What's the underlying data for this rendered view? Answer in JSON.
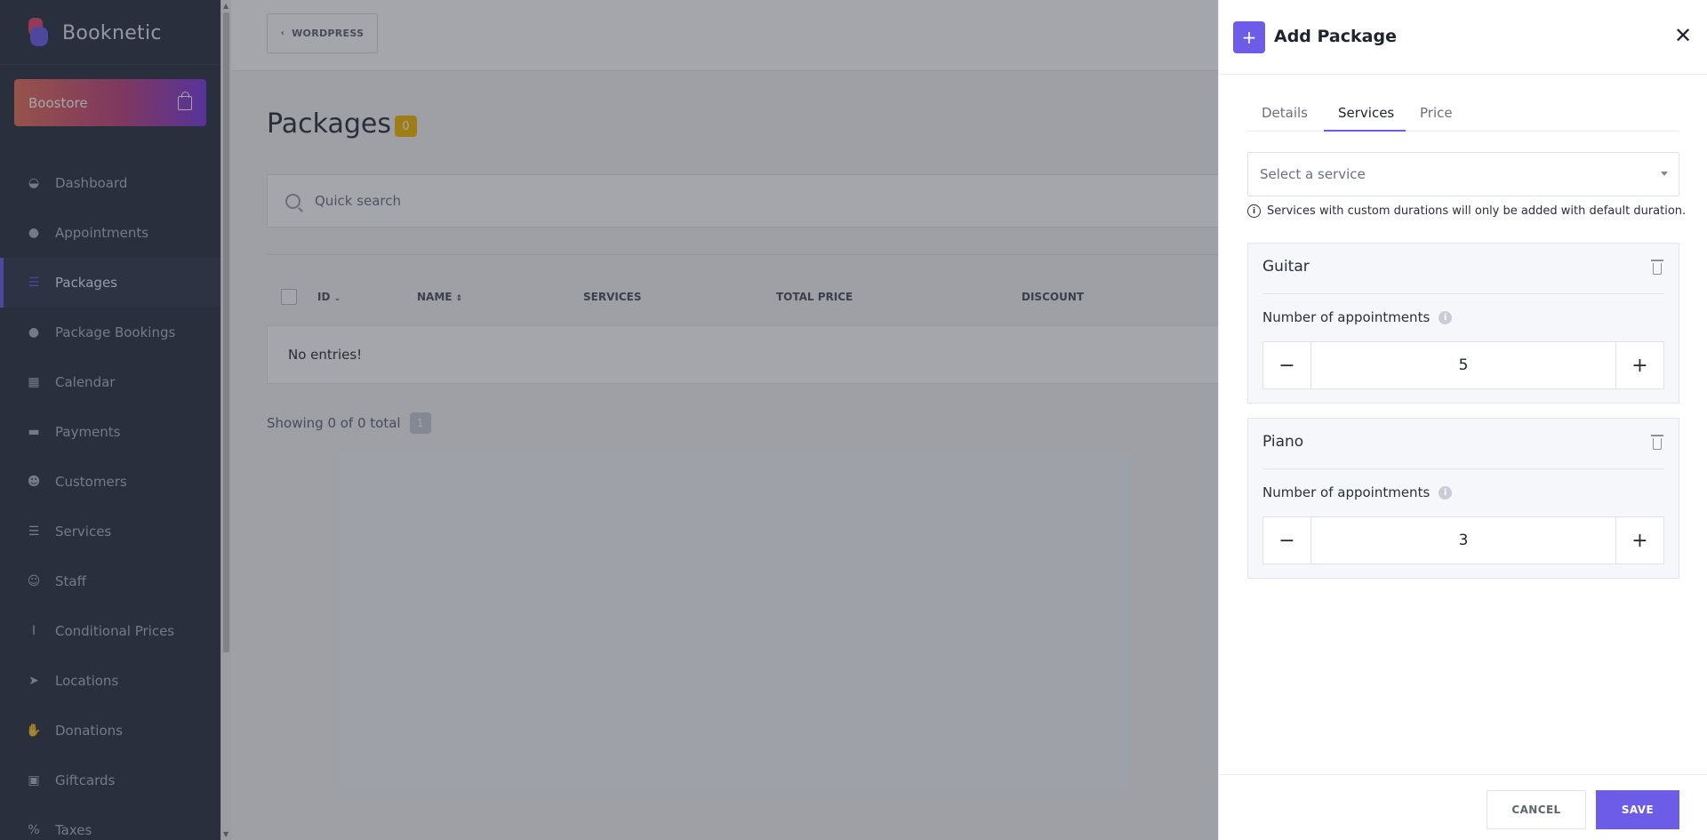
{
  "app": {
    "name": "Booknetic",
    "boostore": "Boostore"
  },
  "sidebar": {
    "items": [
      {
        "label": "Dashboard",
        "icon": "dashboard-icon"
      },
      {
        "label": "Appointments",
        "icon": "clock-icon"
      },
      {
        "label": "Packages",
        "icon": "list-icon"
      },
      {
        "label": "Package Bookings",
        "icon": "clock-icon"
      },
      {
        "label": "Calendar",
        "icon": "calendar-icon"
      },
      {
        "label": "Payments",
        "icon": "wallet-icon"
      },
      {
        "label": "Customers",
        "icon": "users-icon"
      },
      {
        "label": "Services",
        "icon": "list-icon"
      },
      {
        "label": "Staff",
        "icon": "user-icon"
      },
      {
        "label": "Conditional Prices",
        "icon": "text-cursor-icon"
      },
      {
        "label": "Locations",
        "icon": "location-arrow-icon"
      },
      {
        "label": "Donations",
        "icon": "hand-icon"
      },
      {
        "label": "Giftcards",
        "icon": "gift-icon"
      },
      {
        "label": "Taxes",
        "icon": "percent-icon"
      }
    ],
    "active_index": 2
  },
  "main": {
    "back_button": "WORDPRESS",
    "title": "Packages",
    "count": "0",
    "search_placeholder": "Quick search",
    "columns": [
      "ID",
      "NAME",
      "SERVICES",
      "TOTAL PRICE",
      "DISCOUNT"
    ],
    "empty_text": "No entries!",
    "showing": "Showing 0 of 0 total",
    "page": "1"
  },
  "panel": {
    "title": "Add Package",
    "tabs": [
      "Details",
      "Services",
      "Price"
    ],
    "active_tab": "Services",
    "select_placeholder": "Select a service",
    "note": "Services with custom durations will only be added with default duration.",
    "services": [
      {
        "name": "Guitar",
        "label": "Number of appointments",
        "value": "5"
      },
      {
        "name": "Piano",
        "label": "Number of appointments",
        "value": "3"
      }
    ],
    "cancel_label": "CANCEL",
    "save_label": "SAVE"
  },
  "colors": {
    "accent": "#6c5ce7",
    "sidebar": "#2c3342",
    "badge": "#f5b800"
  }
}
